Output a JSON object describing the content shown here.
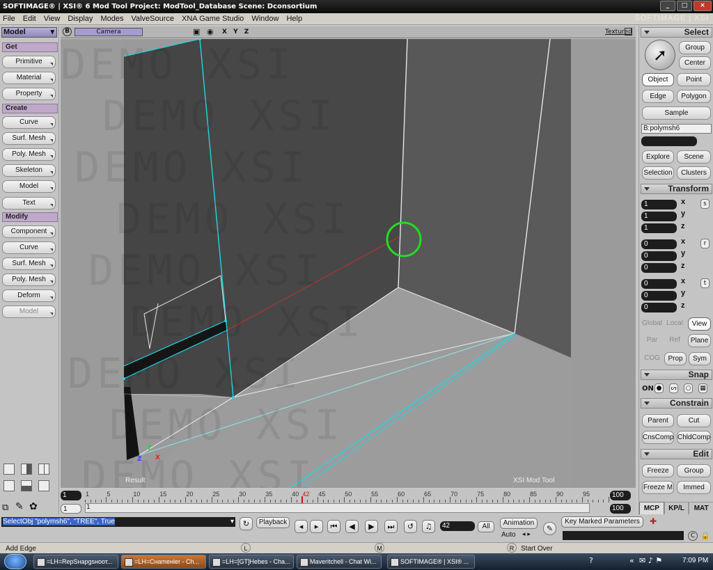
{
  "titlebar": {
    "title": "SOFTIMAGE® | XSI® 6 Mod Tool Project: ModTool_Database    Scene: Dconsortium"
  },
  "menubar": {
    "items": [
      "File",
      "Edit",
      "View",
      "Display",
      "Modes",
      "ValveSource",
      "XNA Game Studio",
      "Window",
      "Help"
    ],
    "brand": "SOFTIMAGE | XSI"
  },
  "left": {
    "mode": "Model",
    "get_header": "Get",
    "get": [
      "Primitive",
      "Material",
      "Property"
    ],
    "create_header": "Create",
    "create": [
      "Curve",
      "Surf. Mesh",
      "Poly. Mesh",
      "Skeleton",
      "Model",
      "Text"
    ],
    "modify_header": "Modify",
    "modify": [
      "Component",
      "Curve",
      "Surf. Mesh",
      "Poly. Mesh",
      "Deform",
      "Model"
    ]
  },
  "viewport": {
    "header_label": "B",
    "camera": "Camera",
    "axes": "X Y Z",
    "mode": "Textured",
    "label_left": "Result",
    "label_right": "XSI Mod Tool",
    "watermark": "DEMO XSI",
    "axis_icons": {
      "y": "Y",
      "x": "X",
      "z": "Z"
    }
  },
  "right": {
    "select_header": "Select",
    "group": "Group",
    "center": "Center",
    "object": "Object",
    "point": "Point",
    "edge": "Edge",
    "polygon": "Polygon",
    "sample": "Sample",
    "selected_name": "B:polymsh6",
    "explore": "Explore",
    "scene": "Scene",
    "selection": "Selection",
    "clusters": "Clusters",
    "transform_header": "Transform",
    "scale": [
      "1",
      "1",
      "1"
    ],
    "rotate": [
      "0",
      "0",
      "0"
    ],
    "translate": [
      "0",
      "0",
      "0"
    ],
    "axes": [
      "x",
      "y",
      "z"
    ],
    "scale_label": "s",
    "rot_label": "r",
    "trans_label": "t",
    "global": "Global",
    "local": "Local",
    "view": "View",
    "par": "Par",
    "ref": "Ref",
    "plane": "Plane",
    "cog": "COG",
    "prop": "Prop",
    "sym": "Sym",
    "snap_header": "Snap",
    "snap_on": "ON",
    "constrain_header": "Constrain",
    "parent": "Parent",
    "cut": "Cut",
    "cnscomp": "CnsComp",
    "childcomp": "ChldComp",
    "edit_header": "Edit",
    "freeze": "Freeze",
    "group2": "Group",
    "freeze_m": "Freeze M",
    "immed": "Immed",
    "tabs": [
      "MCP",
      "KP/L",
      "MAT"
    ]
  },
  "timeline": {
    "start": "1",
    "start2": "1",
    "end": "100",
    "end2": "100",
    "current": "42",
    "ticks": [
      "1",
      "5",
      "10",
      "15",
      "20",
      "25",
      "30",
      "35",
      "40",
      "42",
      "45",
      "50",
      "55",
      "60",
      "65",
      "70",
      "75",
      "80",
      "85",
      "90",
      "95"
    ],
    "marker_label": "1"
  },
  "cmd": {
    "command": "SelectObj \"polymsh6\", \"TREE\", True",
    "playback": "Playback",
    "frame": "42",
    "all": "All",
    "animation": "Animation",
    "auto": "Auto",
    "key_marked": "Key Marked Parameters"
  },
  "status": {
    "left": "Add Edge",
    "l_marker": "L",
    "m_marker": "M",
    "r_marker": "R",
    "right": "Start Over"
  },
  "taskbar": {
    "tasks": [
      "=LH=RepSнapgsноот...",
      "=LH=Cнameнlеr - Ch...",
      "=LH=[GT]Hebes - Cha...",
      "Maveritchell - Chat Wi...",
      "SOFTIMAGE® | XSI® ..."
    ],
    "time": "7:09 PM"
  },
  "colors": {
    "selection_highlight": "#00ffff",
    "cursor_ring": "#22dd22",
    "edge_red": "#c03030",
    "timeline_marker": "#d01010",
    "panel_header_purple": "#bfa8c9"
  }
}
